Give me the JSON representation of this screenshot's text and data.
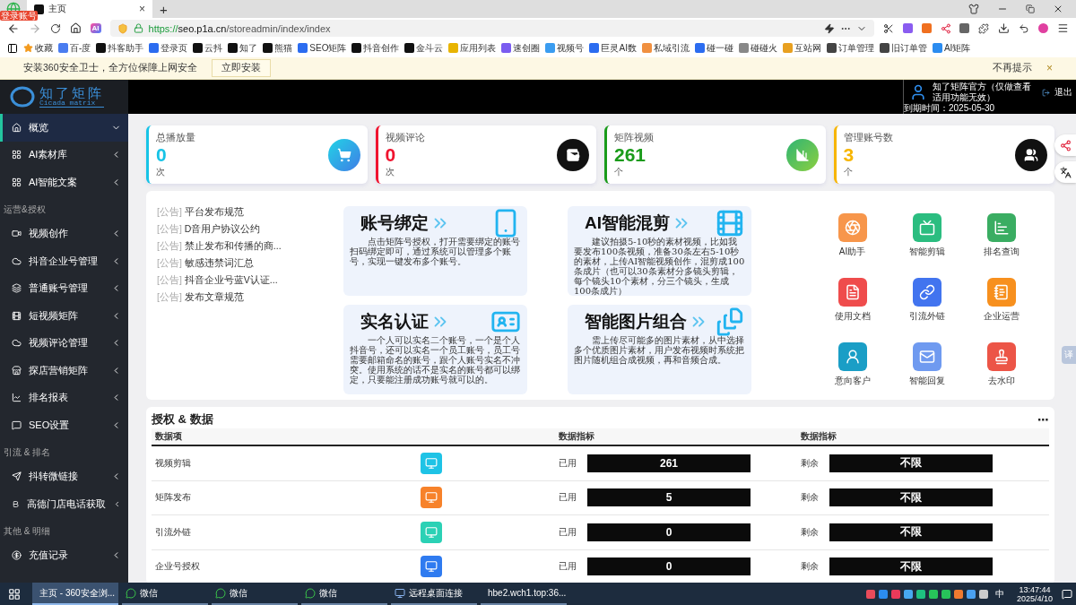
{
  "browser": {
    "badge": "登录账号",
    "tabs": [
      {
        "title": "主页",
        "close": "×",
        "selected": true
      }
    ],
    "new_tab": "+",
    "ai_button": "AI",
    "url": {
      "scheme": "https://",
      "host": "seo.p1a.cn",
      "path": "/storeadmin/index/index"
    },
    "bookmarks": [
      "收藏",
      "百-度",
      "抖客助手",
      "登录页",
      "云抖",
      "知了",
      "熊猫",
      "SEO矩阵",
      "抖音创作",
      "金斗云",
      "应用列表",
      "速创圈",
      "视频号",
      "巨灵AI数",
      "私域引流",
      "碰一碰",
      "碰碰火",
      "互站网",
      "订单管理",
      "旧订单管",
      "AI矩阵"
    ],
    "infobar": {
      "message": "安装360安全卫士，全方位保障上网安全",
      "button": "立即安装",
      "dismiss": "不再提示",
      "close": "×"
    }
  },
  "sidebar": {
    "logo": {
      "title": "知了矩阵",
      "subtitle": "Cicada matrix"
    },
    "items": [
      {
        "kind": "item",
        "label": "概览",
        "selected": true,
        "expanded": true
      },
      {
        "kind": "item",
        "label": "AI素材库",
        "selected": false,
        "expanded": false
      },
      {
        "kind": "item",
        "label": "AI智能文案",
        "selected": false,
        "expanded": false
      },
      {
        "kind": "section",
        "label": "运营&授权"
      },
      {
        "kind": "item",
        "label": "视频创作",
        "selected": false,
        "expanded": false
      },
      {
        "kind": "item",
        "label": "抖音企业号管理",
        "selected": false,
        "expanded": false
      },
      {
        "kind": "item",
        "label": "普通账号管理",
        "selected": false,
        "expanded": false
      },
      {
        "kind": "item",
        "label": "短视频矩阵",
        "selected": false,
        "expanded": false
      },
      {
        "kind": "item",
        "label": "视频评论管理",
        "selected": false,
        "expanded": false
      },
      {
        "kind": "item",
        "label": "探店营销矩阵",
        "selected": false,
        "expanded": false
      },
      {
        "kind": "item",
        "label": "排名报表",
        "selected": false,
        "expanded": false
      },
      {
        "kind": "item",
        "label": "SEO设置",
        "selected": false,
        "expanded": false
      },
      {
        "kind": "section",
        "label": "引流 & 排名"
      },
      {
        "kind": "item",
        "label": "抖转微链接",
        "selected": false,
        "expanded": false
      },
      {
        "kind": "item",
        "label": "高德门店电话获取",
        "selected": false,
        "expanded": false
      },
      {
        "kind": "section",
        "label": "其他 & 明细"
      },
      {
        "kind": "item",
        "label": "充值记录",
        "selected": false,
        "expanded": false
      }
    ]
  },
  "header": {
    "user": {
      "name": "知了矩阵官方（仅做查看适用功能无效）",
      "expiry": "到期时间：2025-05-30",
      "logout": "退出"
    }
  },
  "stats": [
    {
      "label": "总播放量",
      "value": "0",
      "unit": "次",
      "color": "#17c3e6"
    },
    {
      "label": "视频评论",
      "value": "0",
      "unit": "次",
      "color": "#f0142f"
    },
    {
      "label": "矩阵视频",
      "value": "261",
      "unit": "个",
      "color": "#1a9b1a"
    },
    {
      "label": "管理账号数",
      "value": "3",
      "unit": "个",
      "color": "#f7b500"
    }
  ],
  "notices": [
    {
      "tag": "[公告]",
      "title": "平台发布规范"
    },
    {
      "tag": "[公告]",
      "title": "D音用户协议公约"
    },
    {
      "tag": "[公告]",
      "title": "禁止发布和传播的商..."
    },
    {
      "tag": "[公告]",
      "title": "敏感违禁词汇总"
    },
    {
      "tag": "[公告]",
      "title": "抖音企业号蓝V认证..."
    },
    {
      "tag": "[公告]",
      "title": "发布文章规范"
    }
  ],
  "features": [
    {
      "title": "账号绑定",
      "text": "点击矩阵号授权，打开需要绑定的账号扫码绑定即可，通过系统可以管理多个账号，实现一键发布多个账号。"
    },
    {
      "title": "AI智能混剪",
      "text": "建议拍摄5-10秒的素材视频，比如我要发布100条视频，准备30条左右5-10秒的素材，上传AI智能视频创作，混剪成100条成片（也可以30条素材分多镜头剪辑，每个镜头10个素材，分三个镜头，生成100条成片）"
    },
    {
      "title": "实名认证",
      "text": "一个人可以实名二个账号，一个是个人抖音号，还可以实名一个员工账号，员工号需要邮箱命名的账号，跟个人账号实名不冲突。使用系统的话不是实名的账号都可以绑定，只要能注册成功账号就可以的。"
    },
    {
      "title": "智能图片组合",
      "text": "需上传尽可能多的图片素材，从中选择多个优质图片素材，用户发布视频时系统把图片随机组合成视频，再和音频合成。"
    }
  ],
  "apps": [
    {
      "label": "AI助手",
      "color": "#f7964b"
    },
    {
      "label": "智能剪辑",
      "color": "#2bbd80"
    },
    {
      "label": "排名查询",
      "color": "#3aad62"
    },
    {
      "label": "使用文档",
      "color": "#ef4c4c"
    },
    {
      "label": "引流外链",
      "color": "#4274ef"
    },
    {
      "label": "企业运营",
      "color": "#f7901e"
    },
    {
      "label": "意向客户",
      "color": "#1a9ec6"
    },
    {
      "label": "智能回复",
      "color": "#6f9af0"
    },
    {
      "label": "去水印",
      "color": "#ec5547"
    }
  ],
  "side_float": {
    "translate": "译"
  },
  "table": {
    "title": "授权 & 数据",
    "more": "⋯",
    "columns": [
      "数据项",
      "数据指标",
      "数据指标"
    ],
    "rows": [
      {
        "name": "视频剪辑",
        "color": "#1ec3e6",
        "used_label": "已用",
        "used": "261",
        "left_label": "剩余",
        "left": "不限"
      },
      {
        "name": "矩阵发布",
        "color": "#f7822a",
        "used_label": "已用",
        "used": "5",
        "left_label": "剩余",
        "left": "不限"
      },
      {
        "name": "引流外链",
        "color": "#2bd1b5",
        "used_label": "已用",
        "used": "0",
        "left_label": "剩余",
        "left": "不限"
      },
      {
        "name": "企业号授权",
        "color": "#2f7bf0",
        "used_label": "已用",
        "used": "0",
        "left_label": "剩余",
        "left": "不限"
      }
    ]
  },
  "taskbar": {
    "items": [
      {
        "label": "主页 - 360安全浏...",
        "selected": true
      },
      {
        "label": "微信",
        "selected": false
      },
      {
        "label": "微信",
        "selected": false
      },
      {
        "label": "微信",
        "selected": false
      },
      {
        "label": "远程桌面连接",
        "selected": false
      },
      {
        "label": "hbe2.wch1.top:36...",
        "selected": false
      }
    ],
    "ime": "中",
    "time": "13:47:44",
    "date": "2025/4/10"
  }
}
